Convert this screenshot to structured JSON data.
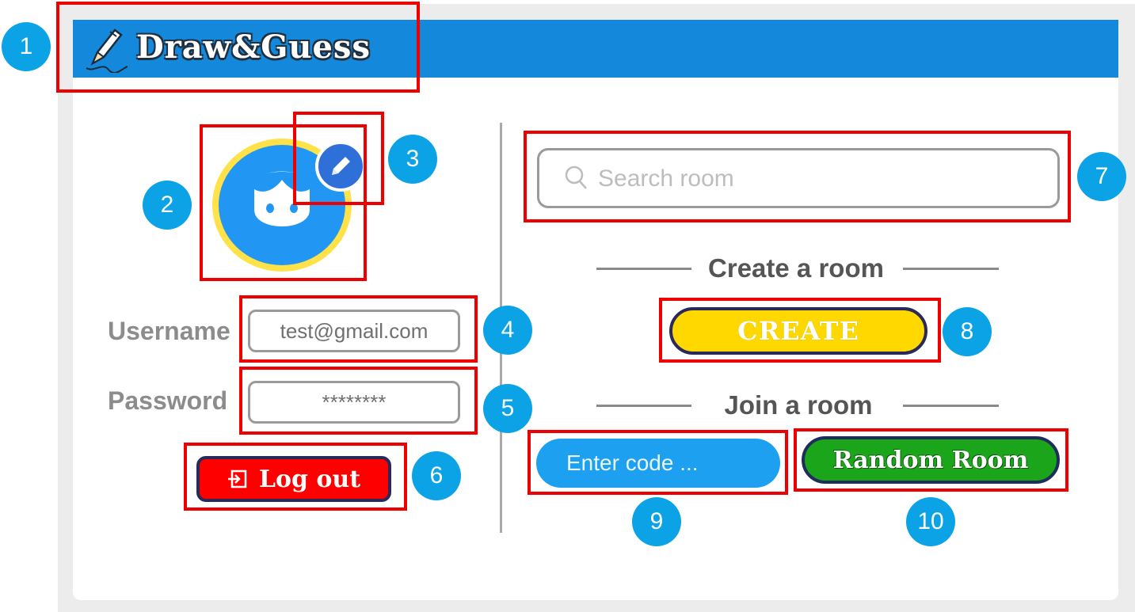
{
  "app": {
    "title": "Draw&Guess",
    "logo_icon": "pencil-icon",
    "header_color": "#1488db"
  },
  "profile": {
    "avatar_icon": "avatar-face-icon",
    "edit_icon": "pencil-edit-icon",
    "username_label": "Username",
    "username_value": "test@gmail.com",
    "password_label": "Password",
    "password_value": "********",
    "logout_icon": "logout-icon",
    "logout_label": "Log out"
  },
  "rooms": {
    "search_icon": "search-icon",
    "search_placeholder": "Search room",
    "create_heading": "Create a room",
    "create_label": "CREATE",
    "join_heading": "Join a room",
    "code_placeholder": "Enter code ...",
    "random_label": "Random Room"
  },
  "annotations": [
    "1",
    "2",
    "3",
    "4",
    "5",
    "6",
    "7",
    "8",
    "9",
    "10"
  ],
  "colors": {
    "create_button": "#ffd800",
    "logout_button": "#ff0000",
    "random_button": "#1aa51a",
    "code_input": "#1ea0f0",
    "annotation_badge": "#0ba3e6",
    "annotation_box": "#ee0000"
  }
}
